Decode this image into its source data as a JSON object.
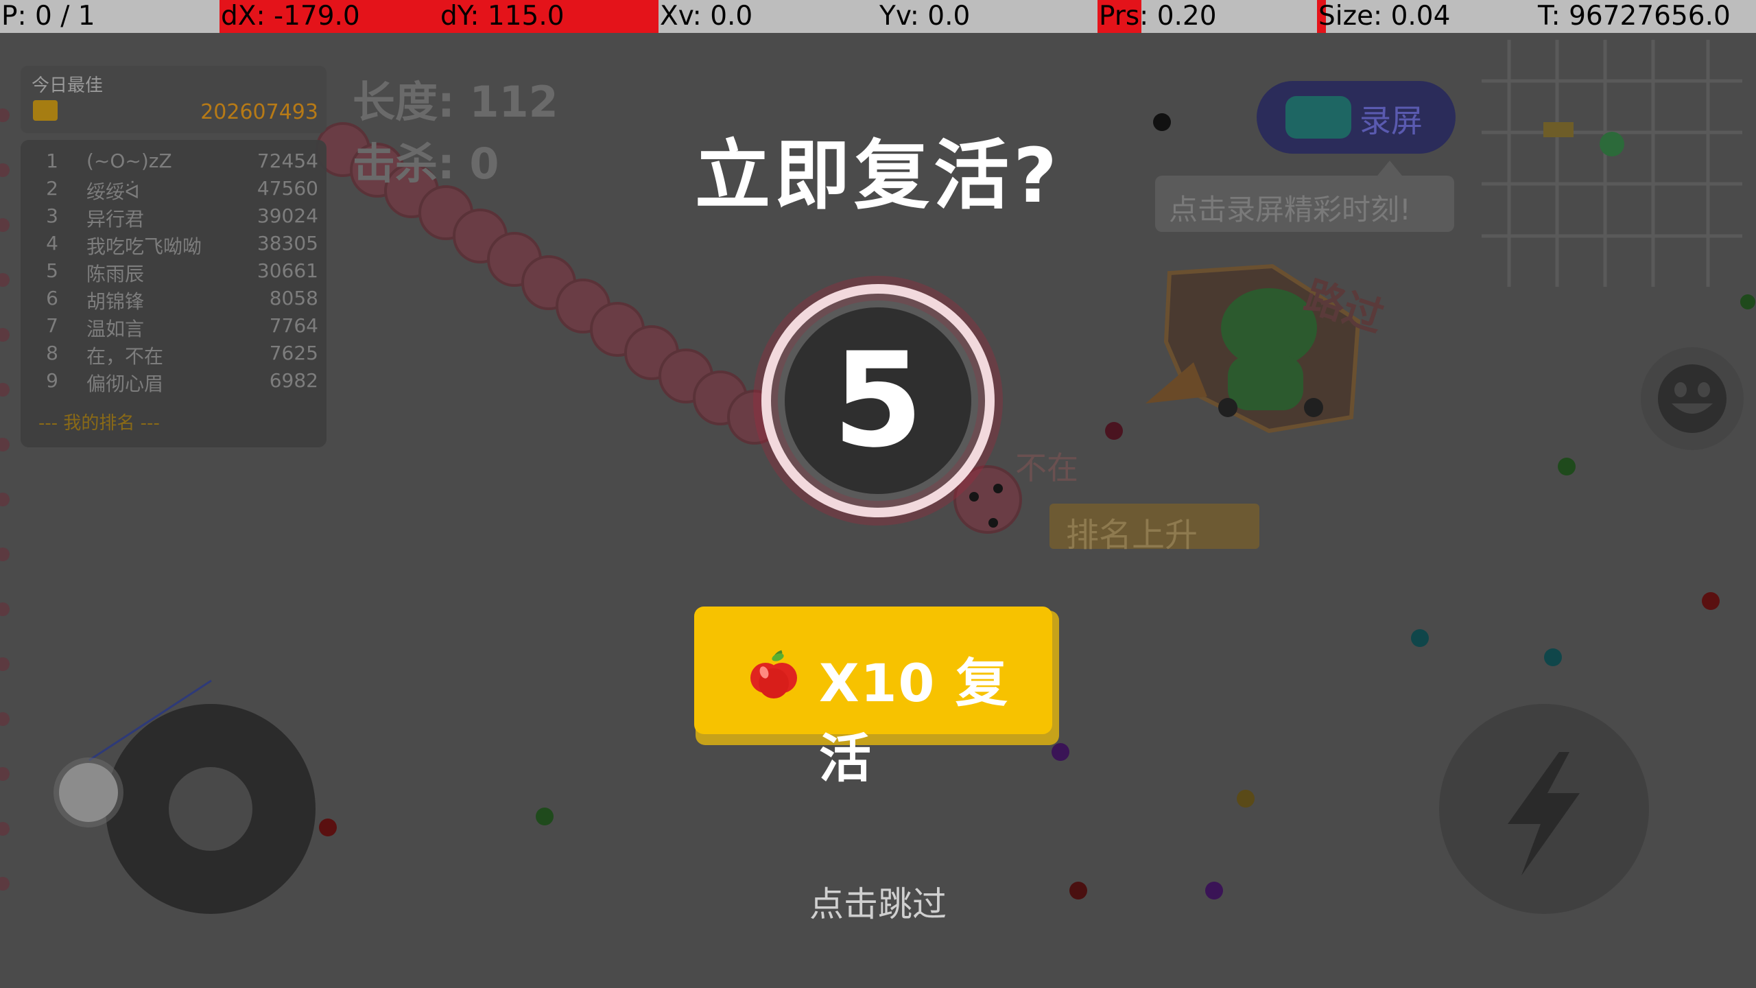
{
  "statusbar": {
    "p": "P: 0 / 1",
    "dx": "dX: -179.0",
    "dy": "dY: 115.0",
    "xv": "Xv: 0.0",
    "yv": "Yv: 0.0",
    "prs": "Prs: 0.20",
    "size": "Size: 0.04",
    "t": "T: 96727656.0",
    "prs_fill": 0.2,
    "size_fill": 0.04,
    "accent_color": "#e4131a"
  },
  "best": {
    "title": "今日最佳",
    "score": "202607493"
  },
  "leaderboard": {
    "rows": [
      {
        "rank": "1",
        "name": "(~O~)zZ",
        "score": "72454"
      },
      {
        "rank": "2",
        "name": "绥绥ᐛ",
        "score": "47560"
      },
      {
        "rank": "3",
        "name": "异行君",
        "score": "39024"
      },
      {
        "rank": "4",
        "name": "我吃吃飞呦呦",
        "score": "38305"
      },
      {
        "rank": "5",
        "name": "陈雨辰",
        "score": "30661"
      },
      {
        "rank": "6",
        "name": "胡锦锋",
        "score": "8058"
      },
      {
        "rank": "7",
        "name": "温如言",
        "score": "7764"
      },
      {
        "rank": "8",
        "name": "在，不在",
        "score": "7625"
      },
      {
        "rank": "9",
        "name": "偏彻心眉",
        "score": "6982"
      }
    ],
    "footer": "---  我的排名  ---"
  },
  "hud": {
    "length_label": "长度:",
    "length_value": "112",
    "kills_label": "击杀:",
    "kills_value": "0"
  },
  "record": {
    "label": "录屏",
    "tip": "点击录屏精彩时刻!"
  },
  "world_text": {
    "player_name": "不在",
    "rank_up": "排名上升",
    "sticker_text": "路过"
  },
  "modal": {
    "title": "立即复活?",
    "countdown": "5",
    "revive_label": "X10 复活",
    "skip_label": "点击跳过"
  },
  "icons": {
    "record": "video-camera-icon",
    "apple": "apple-icon",
    "boost": "lightning-icon",
    "emoji": "smiley-face-icon"
  },
  "colors": {
    "revive_button": "#f7c200",
    "snake_body": "#b04a5a"
  }
}
